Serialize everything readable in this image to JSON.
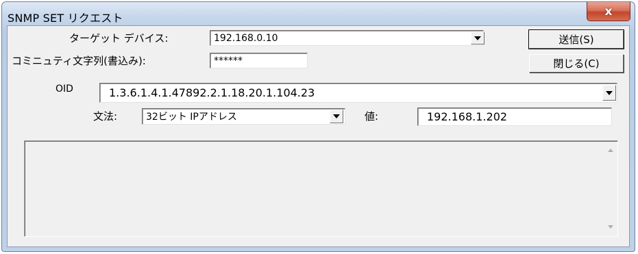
{
  "window": {
    "title": "SNMP SET リクエスト",
    "close_label": "x"
  },
  "form": {
    "target_device_label": "ターゲット デバイス:",
    "target_device_value": "192.168.0.10",
    "community_label": "コミニュティ文字列(書込み):",
    "community_value": "******",
    "oid_label": "OID",
    "oid_value": "1.3.6.1.4.1.47892.2.1.18.20.1.104.23",
    "syntax_label": "文法:",
    "syntax_value": "32ビット IPアドレス",
    "value_label": "値:",
    "value_value": "192.168.1.202"
  },
  "buttons": {
    "send_label": "送信(S)",
    "close_label": "閉じる(C)"
  },
  "status": {
    "text": ""
  },
  "icons": {
    "dropdown": "chevron-down-icon",
    "close": "close-icon",
    "scroll_up": "scroll-up-icon",
    "scroll_down": "scroll-down-icon"
  },
  "colors": {
    "title_bar": "#c7d8ec",
    "close_button": "#c3472c",
    "client_bg": "#f0f0f0"
  }
}
